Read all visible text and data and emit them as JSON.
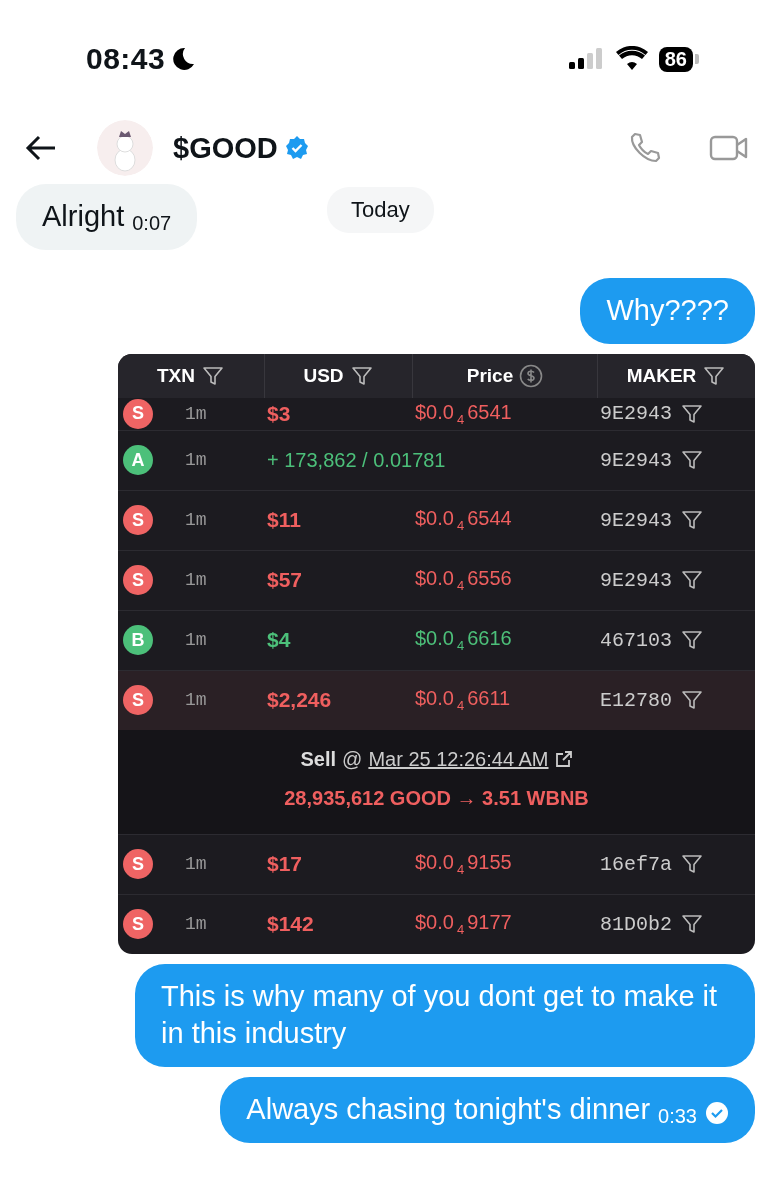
{
  "status_bar": {
    "time": "08:43",
    "battery": "86"
  },
  "header": {
    "name": "$GOOD",
    "verified": true
  },
  "date_pill": "Today",
  "messages": [
    {
      "kind": "received",
      "text": "Alright",
      "time": "0:07"
    },
    {
      "kind": "sent",
      "text": "Why????"
    },
    {
      "kind": "table",
      "columns": [
        {
          "label": "TXN",
          "kind": "filter"
        },
        {
          "label": "USD",
          "kind": "filter"
        },
        {
          "label": "Price",
          "kind": "dollar"
        },
        {
          "label": "MAKER",
          "kind": "filter"
        }
      ],
      "rows": [
        {
          "kind": "sell",
          "badge": "S",
          "age": "1m",
          "usd": "$3",
          "price_head": "$0.0",
          "price_zeros": "4",
          "price_tail": "6541",
          "maker": "9E2943",
          "partial": true,
          "expanded": false
        },
        {
          "kind": "add",
          "badge": "A",
          "age": "1m",
          "amount": "+ 173,862 / 0.01781",
          "maker": "9E2943",
          "partial": false,
          "expanded": false
        },
        {
          "kind": "sell",
          "badge": "S",
          "age": "1m",
          "usd": "$11",
          "price_head": "$0.0",
          "price_zeros": "4",
          "price_tail": "6544",
          "maker": "9E2943",
          "partial": false,
          "expanded": false
        },
        {
          "kind": "sell",
          "badge": "S",
          "age": "1m",
          "usd": "$57",
          "price_head": "$0.0",
          "price_zeros": "4",
          "price_tail": "6556",
          "maker": "9E2943",
          "partial": false,
          "expanded": false
        },
        {
          "kind": "buy",
          "badge": "B",
          "age": "1m",
          "usd": "$4",
          "price_head": "$0.0",
          "price_zeros": "4",
          "price_tail": "6616",
          "maker": "467103",
          "partial": false,
          "expanded": false
        },
        {
          "kind": "sell",
          "badge": "S",
          "age": "1m",
          "usd": "$2,246",
          "price_head": "$0.0",
          "price_zeros": "4",
          "price_tail": "6611",
          "maker": "E12780",
          "partial": false,
          "expanded": true,
          "detail": {
            "action": "Sell",
            "at": "@",
            "date": "Mar 25 12:26:44 AM",
            "swap": "28,935,612 GOOD → 3.51 WBNB"
          }
        },
        {
          "kind": "sell",
          "badge": "S",
          "age": "1m",
          "usd": "$17",
          "price_head": "$0.0",
          "price_zeros": "4",
          "price_tail": "9155",
          "maker": "16ef7a",
          "partial": false,
          "expanded": false
        },
        {
          "kind": "sell",
          "badge": "S",
          "age": "1m",
          "usd": "$142",
          "price_head": "$0.0",
          "price_zeros": "4",
          "price_tail": "9177",
          "maker": "81D0b2",
          "partial": false,
          "expanded": false
        }
      ]
    },
    {
      "kind": "sent",
      "text": "This is why many of you dont get to make it in this industry"
    },
    {
      "kind": "sent",
      "text": "Always chasing tonight's dinner",
      "time": "0:33",
      "read": true
    }
  ]
}
